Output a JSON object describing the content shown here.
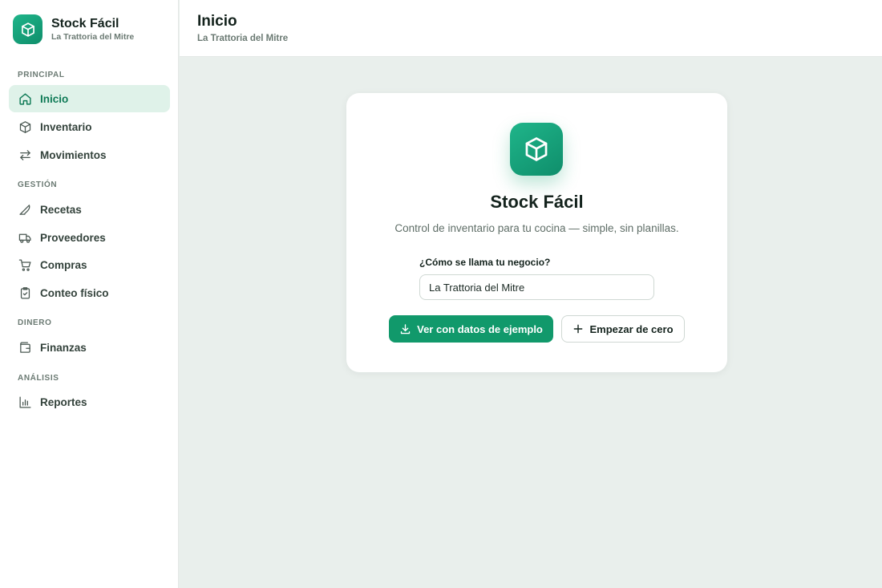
{
  "brand": {
    "title": "Stock Fácil",
    "subtitle": "La Trattoria del Mitre",
    "logo_icon": "box-icon",
    "accent": "#11996b"
  },
  "sidebar": {
    "sections": [
      {
        "label": "PRINCIPAL"
      },
      {
        "label": "GESTIÓN"
      },
      {
        "label": "DINERO"
      },
      {
        "label": "ANÁLISIS"
      }
    ],
    "items": [
      {
        "label": "Inicio",
        "icon": "home-icon",
        "active": true
      },
      {
        "label": "Inventario",
        "icon": "box-icon"
      },
      {
        "label": "Movimientos",
        "icon": "arrows-left-right-icon"
      },
      {
        "label": "Recetas",
        "icon": "chef-knife-icon"
      },
      {
        "label": "Proveedores",
        "icon": "truck-icon"
      },
      {
        "label": "Compras",
        "icon": "shopping-cart-icon"
      },
      {
        "label": "Conteo físico",
        "icon": "clipboard-check-icon"
      },
      {
        "label": "Finanzas",
        "icon": "wallet-icon"
      },
      {
        "label": "Reportes",
        "icon": "bar-chart-icon"
      }
    ]
  },
  "header": {
    "title": "Inicio",
    "subtitle": "La Trattoria del Mitre"
  },
  "onboarding": {
    "title": "Stock Fácil",
    "subtitle": "Control de inventario para tu cocina — simple, sin planillas.",
    "field_label": "¿Cómo se llama tu negocio?",
    "field_value": "La Trattoria del Mitre",
    "primary_button": "Ver con datos de ejemplo",
    "secondary_button": "Empezar de cero"
  }
}
